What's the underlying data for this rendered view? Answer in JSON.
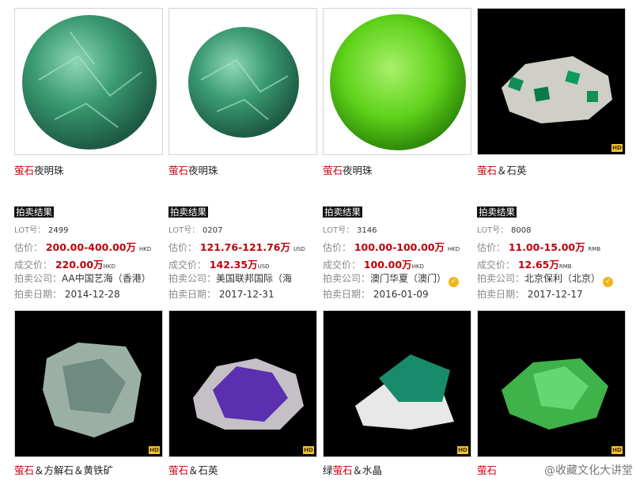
{
  "badge_label": "拍卖结果",
  "labels": {
    "lot": "LOT号：",
    "estimate": "估价：",
    "deal": "成交价：",
    "company": "拍卖公司：",
    "date": "拍卖日期："
  },
  "hd_label": "HD",
  "watermark": "@收藏文化大讲堂",
  "items": [
    {
      "title_hl": "萤石",
      "title_rest": "夜明珠",
      "lot": "2499",
      "estimate": "200.00-400.00万",
      "estimate_unit": "HKD",
      "deal": "220.00",
      "deal_wan": "万",
      "deal_unit": "HKD",
      "company": "AA中国艺海（香港）",
      "date": "2014-12-28",
      "verified": false
    },
    {
      "title_hl": "萤石",
      "title_rest": "夜明珠",
      "lot": "0207",
      "estimate": "121.76-121.76万",
      "estimate_unit": "USD",
      "deal": "142.35",
      "deal_wan": "万",
      "deal_unit": "USD",
      "company": "美国联邦国际（海",
      "date": "2017-12-31",
      "verified": false
    },
    {
      "title_hl": "萤石",
      "title_rest": "夜明珠",
      "lot": "3146",
      "estimate": "100.00-100.00万",
      "estimate_unit": "HKD",
      "deal": "100.00",
      "deal_wan": "万",
      "deal_unit": "HKD",
      "company": "澳门华夏（澳门）",
      "date": "2016-01-09",
      "verified": true
    },
    {
      "title_hl": "萤石",
      "title_rest": "＆石英",
      "lot": "8008",
      "estimate": "11.00-15.00万",
      "estimate_unit": "RMB",
      "deal": "12.65",
      "deal_wan": "万",
      "deal_unit": "RMB",
      "company": "北京保利（北京）",
      "date": "2017-12-17",
      "verified": true
    }
  ],
  "bottom_items": [
    {
      "title_pre": "",
      "title_hl": "萤石",
      "title_rest": "＆方解石＆黄铁矿"
    },
    {
      "title_pre": "",
      "title_hl": "萤石",
      "title_rest": "＆石英"
    },
    {
      "title_pre": "绿",
      "title_hl": "萤石",
      "title_rest": "＆水晶"
    },
    {
      "title_pre": "",
      "title_hl": "萤石",
      "title_rest": ""
    }
  ],
  "colors": {
    "highlight": "#c1000a",
    "badge_bg": "#111111"
  }
}
